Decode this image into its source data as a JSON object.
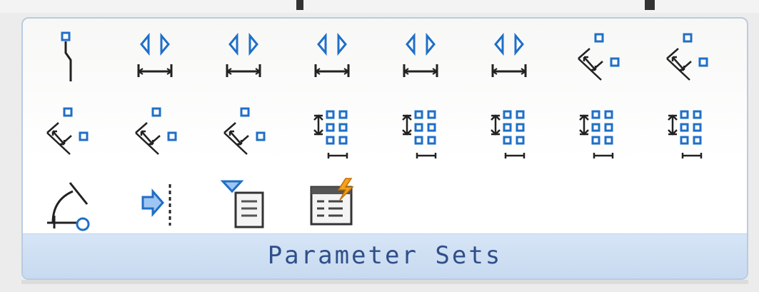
{
  "panel": {
    "label": "Parameter Sets"
  },
  "tools": [
    {
      "icon": "point-grip-icon",
      "name": "point-move"
    },
    {
      "icon": "linear-flip-icon",
      "name": "linear-move"
    },
    {
      "icon": "linear-flip-icon",
      "name": "linear-stretch"
    },
    {
      "icon": "linear-flip-icon",
      "name": "linear-array"
    },
    {
      "icon": "linear-flip-icon",
      "name": "linear-move-pair"
    },
    {
      "icon": "linear-flip-icon",
      "name": "linear-stretch-pair"
    },
    {
      "icon": "polar-stretch-icon",
      "name": "polar-move"
    },
    {
      "icon": "polar-stretch-icon",
      "name": "polar-stretch"
    },
    {
      "icon": "polar-stretch-icon",
      "name": "polar-array"
    },
    {
      "icon": "polar-stretch-icon",
      "name": "polar-move-pair"
    },
    {
      "icon": "polar-stretch-icon",
      "name": "polar-stretch-pair"
    },
    {
      "icon": "xy-grid-icon",
      "name": "xy-move"
    },
    {
      "icon": "xy-grid-icon",
      "name": "xy-move-pair"
    },
    {
      "icon": "xy-grid-icon",
      "name": "xy-move-box-set"
    },
    {
      "icon": "xy-grid-icon",
      "name": "xy-stretch-box-set"
    },
    {
      "icon": "xy-grid-icon",
      "name": "xy-array-box-set"
    },
    {
      "icon": "rotation-set-icon",
      "name": "rotation"
    },
    {
      "icon": "flip-set-icon",
      "name": "flip"
    },
    {
      "icon": "visibility-set-icon",
      "name": "visibility"
    },
    {
      "icon": "lookup-set-icon",
      "name": "lookup"
    }
  ]
}
